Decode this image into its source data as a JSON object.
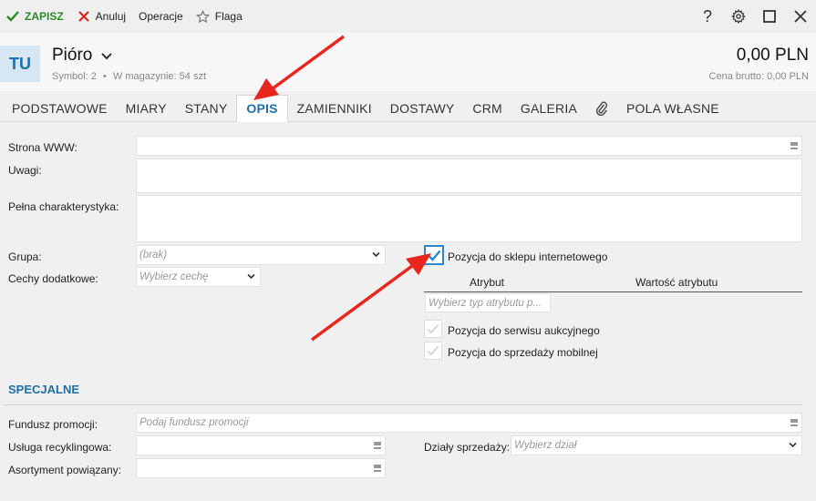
{
  "toolbar": {
    "save_label": "ZAPISZ",
    "cancel_label": "Anuluj",
    "operations_label": "Operacje",
    "flag_label": "Flaga",
    "help_label": "?",
    "accent": "#2a8a2a"
  },
  "header": {
    "avatar": "TU",
    "title": "Pióro",
    "symbol": "Symbol: 2",
    "separator": "•",
    "stock": "W magazynie: 54 szt",
    "price": "0,00 PLN",
    "gross": "Cena brutto: 0,00 PLN"
  },
  "tabs": [
    {
      "label": "PODSTAWOWE"
    },
    {
      "label": "MIARY"
    },
    {
      "label": "STANY"
    },
    {
      "label": "OPIS",
      "active": true
    },
    {
      "label": "ZAMIENNIKI"
    },
    {
      "label": "DOSTAWY"
    },
    {
      "label": "CRM"
    },
    {
      "label": "GALERIA"
    },
    {
      "label": "POLA WŁASNE"
    }
  ],
  "form": {
    "www_label": "Strona WWW:",
    "notes_label": "Uwagi:",
    "full_desc_label": "Pełna charakterystyka:",
    "group_label": "Grupa:",
    "group_value": "(brak)",
    "features_label": "Cechy dodatkowe:",
    "features_placeholder": "Wybierz cechę",
    "shop_checkbox": "Pozycja do sklepu internetowego",
    "attr_col": "Atrybut",
    "attr_value_col": "Wartość atrybutu",
    "attr_type_placeholder": "Wybierz typ atrybutu p...",
    "auction_checkbox": "Pozycja do serwisu aukcyjnego",
    "mobile_checkbox": "Pozycja do sprzedaży mobilnej"
  },
  "special": {
    "title": "SPECJALNE",
    "promo_label": "Fundusz promocji:",
    "promo_placeholder": "Podaj fundusz promocji",
    "recycling_label": "Usługa recyklingowa:",
    "related_label": "Asortyment powiązany:",
    "sales_dept_label": "Działy sprzedaży:",
    "sales_dept_placeholder": "Wybierz dział"
  },
  "colors": {
    "active_tab": "#1f6fa8",
    "checkbox_active": "#2e86c8",
    "arrow": "#e8261e"
  }
}
